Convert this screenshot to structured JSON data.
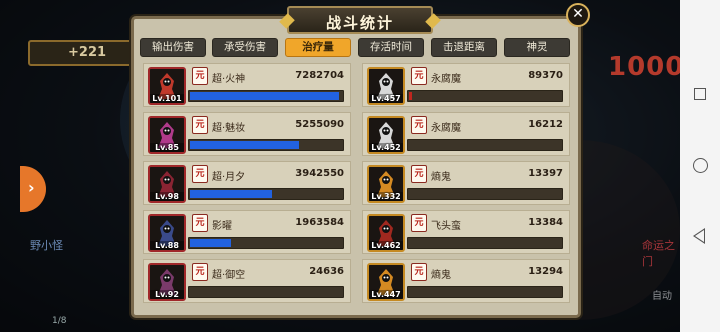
{
  "background": {
    "gold_display": "+221",
    "enemy_number": "1000",
    "left_unit_label": "野小怪",
    "right_unit_label": "命运之门",
    "auto_label": "自动",
    "wave_counter": "1/8",
    "left_button_icon": "chevron-right"
  },
  "dialog": {
    "title": "战斗统计",
    "close_label": "✕",
    "tabs": [
      {
        "label": "输出伤害",
        "active": false
      },
      {
        "label": "承受伤害",
        "active": false
      },
      {
        "label": "治疗量",
        "active": true
      },
      {
        "label": "存活时间",
        "active": false
      },
      {
        "label": "击退距离",
        "active": false
      },
      {
        "label": "神灵",
        "active": false
      }
    ]
  },
  "allies": [
    {
      "name": "超·火神",
      "value": "7282704",
      "level": "Lv.101",
      "badge": "元",
      "fill": 0.98,
      "avatar_color": "#c0392b"
    },
    {
      "name": "超·魅妆",
      "value": "5255090",
      "level": "Lv.85",
      "badge": "元",
      "fill": 0.72,
      "avatar_color": "#b03a8a"
    },
    {
      "name": "超·月夕",
      "value": "3942550",
      "level": "Lv.98",
      "badge": "元",
      "fill": 0.54,
      "avatar_color": "#8a2433"
    },
    {
      "name": "影曜",
      "value": "1963584",
      "level": "Lv.88",
      "badge": "元",
      "fill": 0.27,
      "avatar_color": "#3a4a8a"
    },
    {
      "name": "超·御空",
      "value": "24636",
      "level": "Lv.92",
      "badge": "元",
      "fill": 0.0,
      "avatar_color": "#7a3a6a"
    }
  ],
  "enemies": [
    {
      "name": "永腐魔",
      "value": "89370",
      "level": "Lv.457",
      "badge": "元",
      "fill": 0.02,
      "avatar_color": "#d8d8d8"
    },
    {
      "name": "永腐魔",
      "value": "16212",
      "level": "Lv.452",
      "badge": "元",
      "fill": 0.0,
      "avatar_color": "#d8d8d8"
    },
    {
      "name": "熵鬼",
      "value": "13397",
      "level": "Lv.332",
      "badge": "元",
      "fill": 0.0,
      "avatar_color": "#d58a22"
    },
    {
      "name": "飞头蛮",
      "value": "13384",
      "level": "Lv.462",
      "badge": "元",
      "fill": 0.0,
      "avatar_color": "#a0281f"
    },
    {
      "name": "熵鬼",
      "value": "13294",
      "level": "Lv.447",
      "badge": "元",
      "fill": 0.0,
      "avatar_color": "#d58a22"
    }
  ],
  "colors": {
    "ally_bar": "#2262e0",
    "enemy_bar": "#c0261e",
    "active_tab": "#f0a62a",
    "panel_bg": "#c9c2ab"
  }
}
